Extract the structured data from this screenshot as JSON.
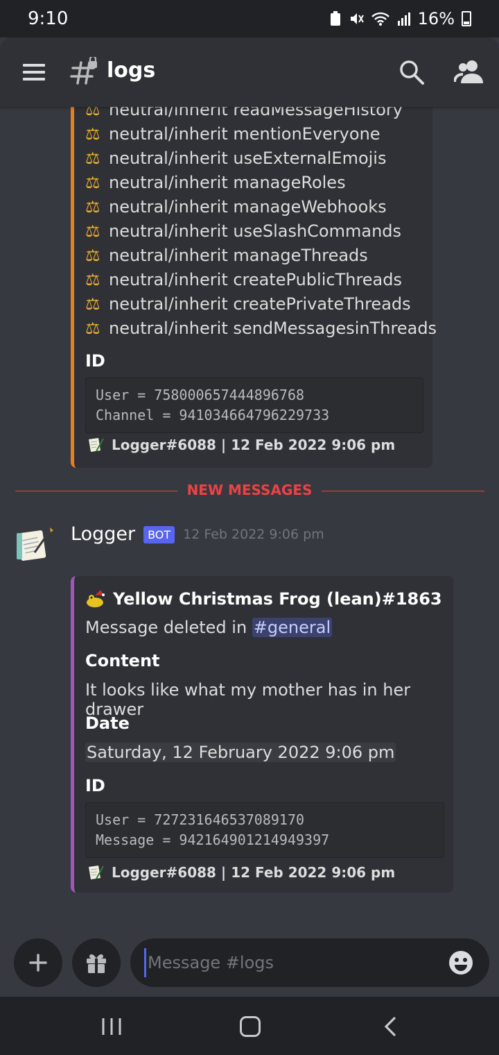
{
  "status_bar": {
    "time": "9:10",
    "battery": "16%"
  },
  "header": {
    "channel_name": "logs",
    "icons": [
      "menu-icon",
      "locked-text-channel-icon",
      "search-icon",
      "members-icon"
    ]
  },
  "embed1": {
    "accent_color": "#e67e22",
    "permissions": [
      "neutral/inherit readMessageHistory",
      "neutral/inherit mentionEveryone",
      "neutral/inherit useExternalEmojis",
      "neutral/inherit manageRoles",
      "neutral/inherit manageWebhooks",
      "neutral/inherit useSlashCommands",
      "neutral/inherit manageThreads",
      "neutral/inherit createPublicThreads",
      "neutral/inherit createPrivateThreads",
      "neutral/inherit sendMessagesinThreads"
    ],
    "id_label": "ID",
    "id_lines": "User = 758000657444896768\nChannel = 941034664796229733",
    "footer": "Logger#6088 | 12 Feb 2022 9:06 pm"
  },
  "divider": {
    "label": "NEW MESSAGES"
  },
  "message": {
    "author": "Logger",
    "bot_tag": "BOT",
    "timestamp": "12 Feb 2022 9:06 pm",
    "embed": {
      "accent_color": "#9b59b6",
      "author": "Yellow Christmas Frog (lean)#1863",
      "description_prefix": "Message deleted in ",
      "channel_mention": "#general",
      "content_label": "Content",
      "content_value": "It looks like what my mother has in her drawer",
      "date_label": "Date",
      "date_value": "Saturday, 12 February 2022 9:06 pm",
      "id_label": "ID",
      "id_lines": "User = 727231646537089170\nMessage = 942164901214949397",
      "footer": "Logger#6088 | 12 Feb 2022 9:06 pm"
    }
  },
  "composer": {
    "placeholder": "Message #logs"
  }
}
